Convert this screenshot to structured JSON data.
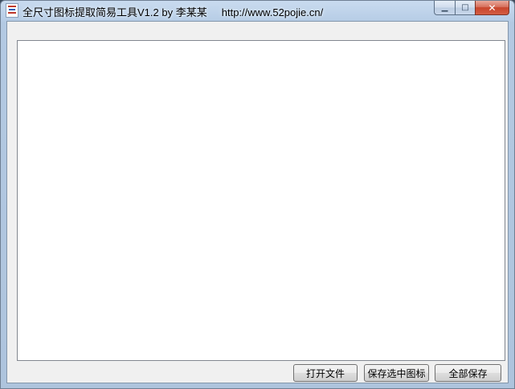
{
  "window": {
    "title": "全尺寸图标提取简易工具V1.2 by 李某某     http://www.52pojie.cn/",
    "minimize_symbol": "▁",
    "maximize_symbol": "□",
    "close_symbol": "✕",
    "icon": "app-icon"
  },
  "icon_list": {
    "items": []
  },
  "buttons": {
    "open_file": "打开文件",
    "save_selected": "保存选中图标",
    "save_all": "全部保存"
  },
  "colors": {
    "close_button": "#c8452c",
    "list_background": "#ffffff",
    "dialog_background": "#f0f0f0"
  }
}
